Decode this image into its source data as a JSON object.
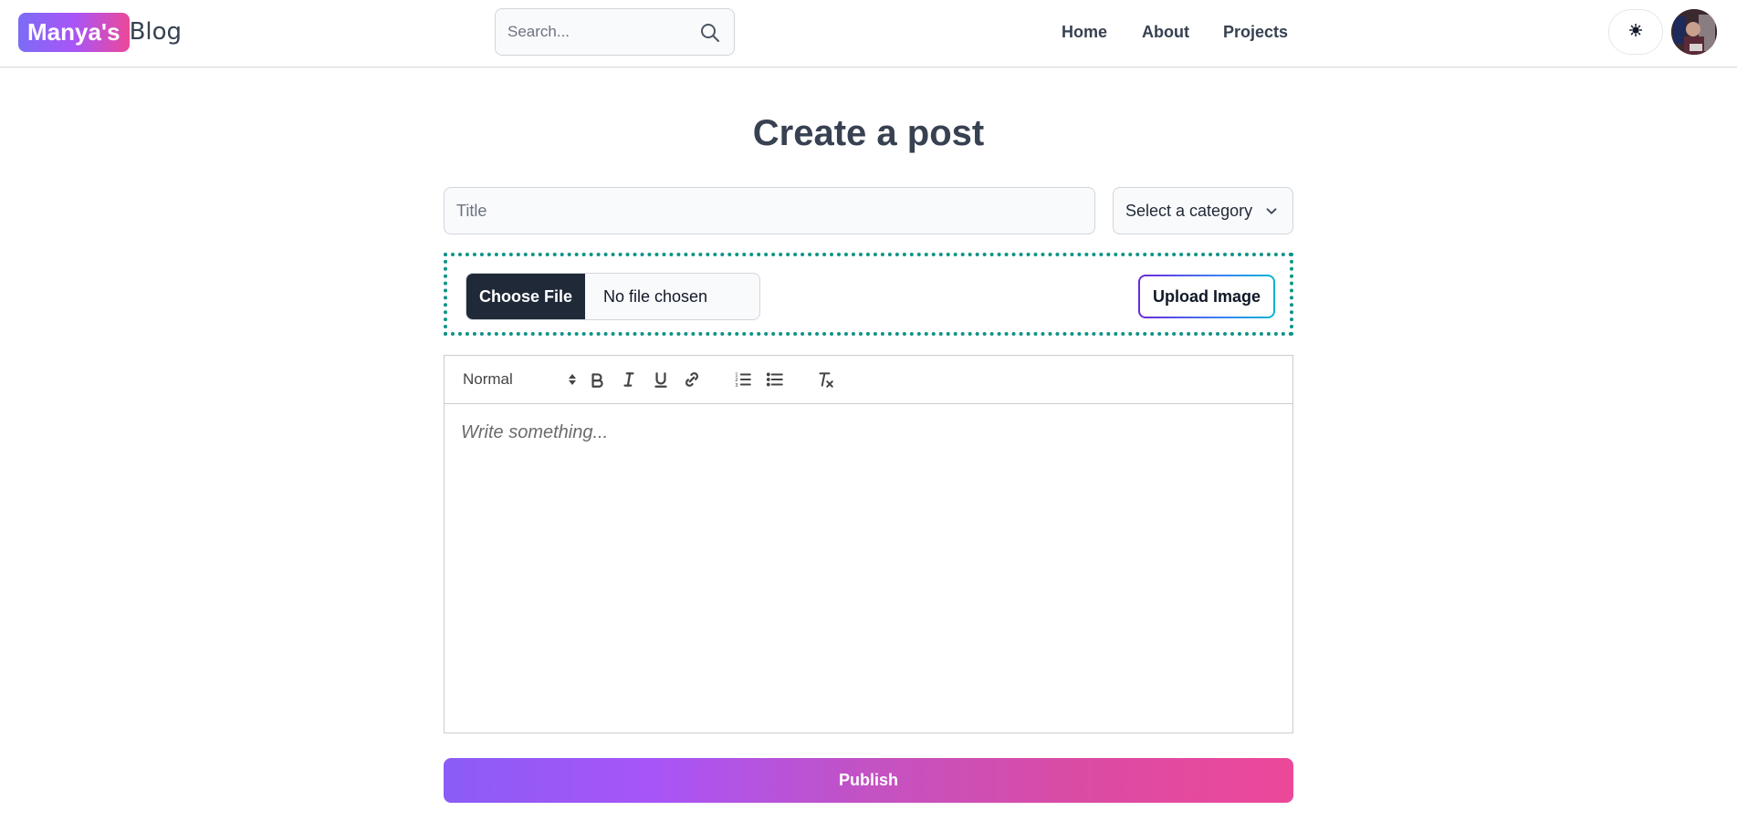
{
  "header": {
    "brand_highlight": "Manya's",
    "brand_rest": "Blog",
    "search_placeholder": "Search...",
    "nav": {
      "home": "Home",
      "about": "About",
      "projects": "Projects"
    },
    "theme_toggle_icon": "sun-icon",
    "avatar": "user-avatar"
  },
  "main": {
    "page_title": "Create a post",
    "title_placeholder": "Title",
    "category_selected": "Select a category",
    "file_button": "Choose File",
    "file_status": "No file chosen",
    "upload_button": "Upload Image",
    "editor": {
      "header_format": "Normal",
      "toolbar_icons": [
        "bold-icon",
        "italic-icon",
        "underline-icon",
        "link-icon",
        "ordered-list-icon",
        "bullet-list-icon",
        "clear-format-icon"
      ],
      "placeholder": "Write something..."
    },
    "publish_button": "Publish"
  },
  "colors": {
    "brand_gradient_start": "#7c6cf5",
    "brand_gradient_end": "#ec4899",
    "upload_zone_border": "#0d9488",
    "file_button_bg": "#1f2937",
    "publish_gradient_start": "#8b5cf6",
    "publish_gradient_end": "#ec4899"
  }
}
